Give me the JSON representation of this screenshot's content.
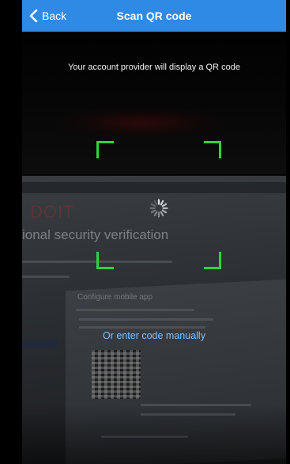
{
  "header": {
    "back_label": "Back",
    "title": "Scan QR code",
    "background_color": "#2f8ae6"
  },
  "scanner": {
    "instruction": "Your account provider will display a QR code",
    "manual_entry_label": "Or enter code manually",
    "frame_color": "#2fd43a",
    "status": "loading"
  },
  "camera_view": {
    "logo_text": "DOIT",
    "heading_text": "ional security verification",
    "doc_title_text": "Configure mobile app"
  },
  "icons": {
    "back": "chevron-left-icon",
    "spinner": "activity-spinner-icon"
  },
  "colors": {
    "link": "#7fc1ff",
    "text": "#f2f2f2"
  }
}
